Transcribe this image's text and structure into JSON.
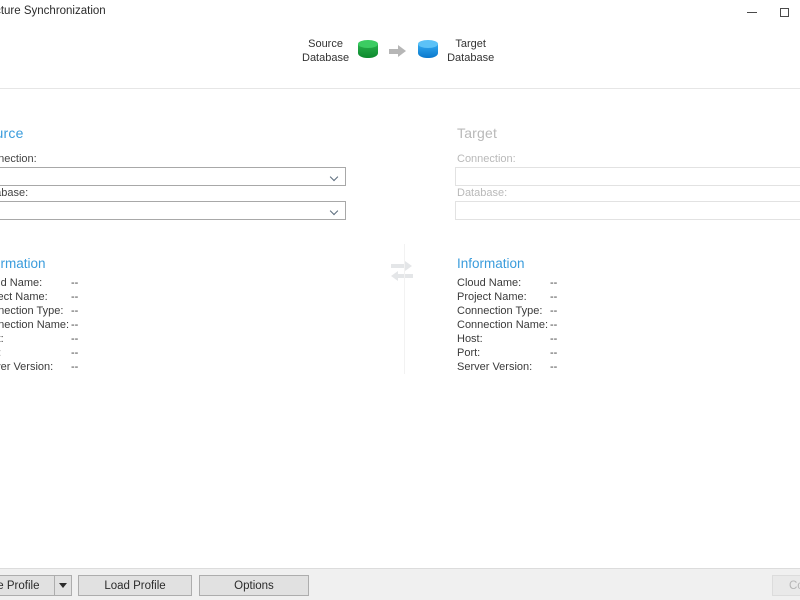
{
  "window": {
    "title": "Structure Synchronization",
    "controls": {
      "minimize": "minimize-window",
      "maximize": "maximize-window"
    }
  },
  "header": {
    "source_label_line1": "Source",
    "source_label_line2": "Database",
    "source_icon_color": "#21a83f",
    "arrow_icon": "arrow-right-icon",
    "arrow_color": "#b6b6b6",
    "target_label_line1": "Target",
    "target_label_line2": "Database",
    "target_icon_color": "#1d8fe0"
  },
  "source_panel": {
    "heading": "Source",
    "heading_color": "#3a9cdc",
    "connection_label": "Connection:",
    "connection_value": "",
    "database_label": "Database:",
    "database_value": "",
    "enabled": true
  },
  "target_panel": {
    "heading": "Target",
    "heading_color": "#b9b9b9",
    "connection_label": "Connection:",
    "connection_value": "",
    "database_label": "Database:",
    "database_value": "",
    "enabled": false
  },
  "swap": {
    "icon": "swap-arrows-icon",
    "enabled": false
  },
  "source_info": {
    "title": "Information",
    "rows": [
      {
        "key": "Cloud Name:",
        "value": "--"
      },
      {
        "key": "Project Name:",
        "value": "--"
      },
      {
        "key": "Connection Type:",
        "value": "--"
      },
      {
        "key": "Connection Name:",
        "value": "--"
      },
      {
        "key": "Host:",
        "value": "--"
      },
      {
        "key": "Port:",
        "value": "--"
      },
      {
        "key": "Server Version:",
        "value": "--"
      }
    ]
  },
  "target_info": {
    "title": "Information",
    "rows": [
      {
        "key": "Cloud Name:",
        "value": "--"
      },
      {
        "key": "Project Name:",
        "value": "--"
      },
      {
        "key": "Connection Type:",
        "value": "--"
      },
      {
        "key": "Connection Name:",
        "value": "--"
      },
      {
        "key": "Host:",
        "value": "--"
      },
      {
        "key": "Port:",
        "value": "--"
      },
      {
        "key": "Server Version:",
        "value": "--"
      }
    ]
  },
  "footer": {
    "save_profile_label": "Save Profile",
    "save_profile_dropdown": "chevron-down-icon",
    "load_profile_label": "Load Profile",
    "options_label": "Options",
    "continue_label": "Continue",
    "continue_enabled": false
  }
}
